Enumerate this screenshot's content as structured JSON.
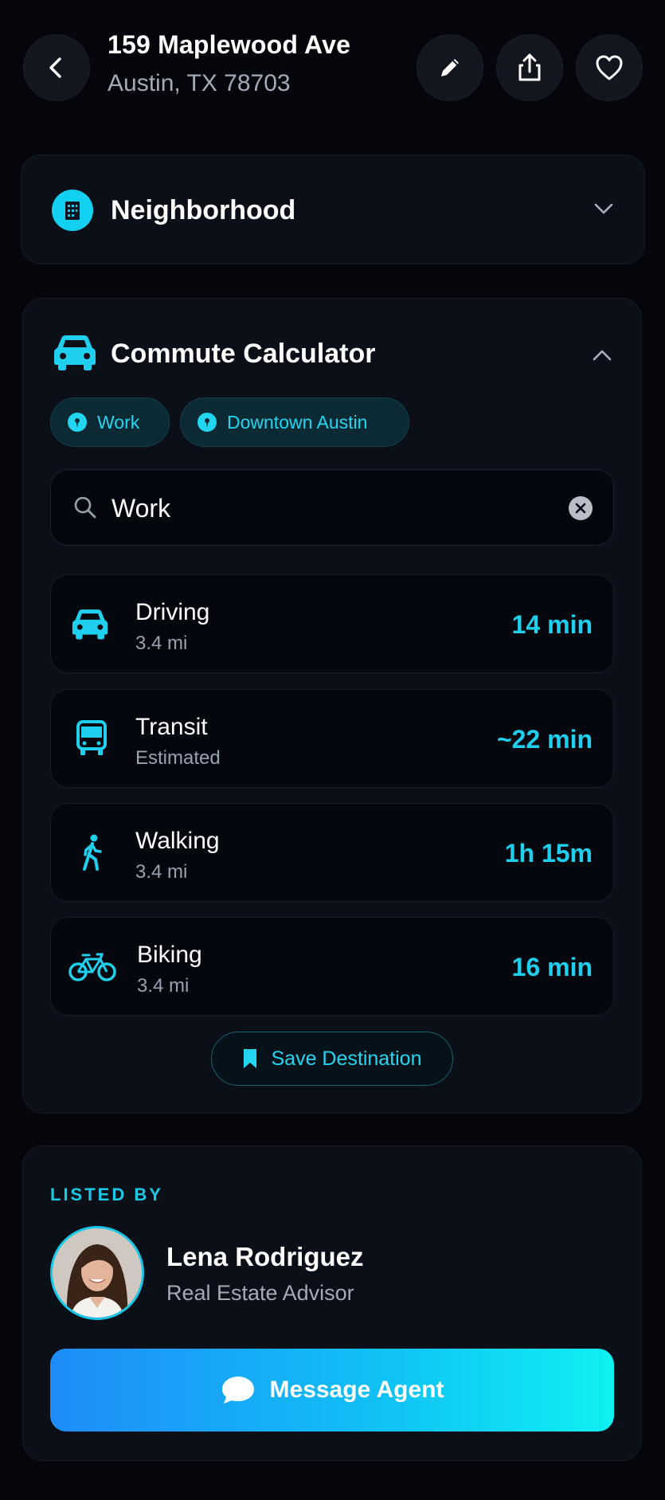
{
  "header": {
    "title": "159 Maplewood Ave",
    "subtitle": "Austin, TX 78703"
  },
  "neighborhood": {
    "title": "Neighborhood"
  },
  "commute": {
    "title": "Commute Calculator",
    "chips": [
      {
        "label": "Work"
      },
      {
        "label": "Downtown Austin"
      }
    ],
    "search": {
      "value": "Work"
    },
    "modes": [
      {
        "name": "Driving",
        "sub": "3.4 mi",
        "time": "14 min",
        "icon": "car-icon"
      },
      {
        "name": "Transit",
        "sub": "Estimated",
        "time": "~22 min",
        "icon": "bus-icon"
      },
      {
        "name": "Walking",
        "sub": "3.4 mi",
        "time": "1h 15m",
        "icon": "walk-icon"
      },
      {
        "name": "Biking",
        "sub": "3.4 mi",
        "time": "16 min",
        "icon": "bike-icon"
      }
    ],
    "save_label": "Save Destination"
  },
  "listing": {
    "label": "LISTED BY",
    "agent_name": "Lena Rodriguez",
    "agent_role": "Real Estate Advisor",
    "message_label": "Message Agent"
  },
  "colors": {
    "accent": "#1fd0ee",
    "background": "#04060c",
    "card": "#0b0f18"
  }
}
